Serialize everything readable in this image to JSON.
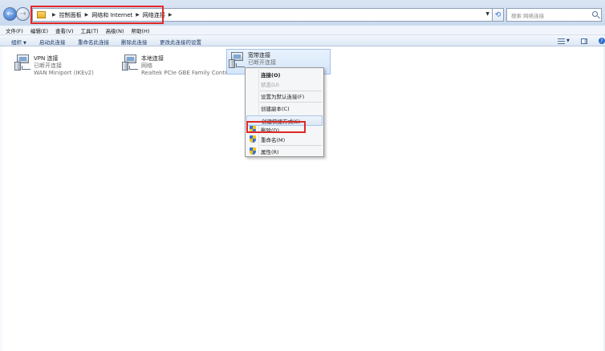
{
  "address": {
    "breadcrumbs": [
      "控制面板",
      "网络和 Internet",
      "网络连接"
    ],
    "search_placeholder": "搜索 网络连接"
  },
  "menubar": {
    "items": [
      "文件(F)",
      "编辑(E)",
      "查看(V)",
      "工具(T)",
      "高级(N)",
      "帮助(H)"
    ]
  },
  "commandbar": {
    "organize": "组织",
    "items": [
      "启动此连接",
      "重命名此连接",
      "删除此连接",
      "更改此连接的设置"
    ]
  },
  "connections": [
    {
      "name": "VPN 连接",
      "status": "已断开连接",
      "device": "WAN Miniport (IKEv2)"
    },
    {
      "name": "本地连接",
      "status": "网络",
      "device": "Realtek PCIe GBE Family Contr..."
    },
    {
      "name": "宽带连接",
      "status": "已断开连接",
      "device": ""
    }
  ],
  "context_menu": {
    "connect": "连接(O)",
    "status": "状态(U)",
    "set_default": "设置为默认连接(F)",
    "create_copy": "创建副本(C)",
    "create_shortcut": "创建快捷方式(S)",
    "delete": "删除(D)",
    "rename": "重命名(M)",
    "properties": "属性(R)"
  },
  "icons": {
    "back": "back-arrow-icon",
    "forward": "forward-arrow-icon",
    "refresh": "refresh-icon",
    "search": "search-icon",
    "uac": "uac-shield-icon"
  },
  "colors": {
    "highlight_box": "#e02828",
    "selection": "#d4e6fa"
  }
}
